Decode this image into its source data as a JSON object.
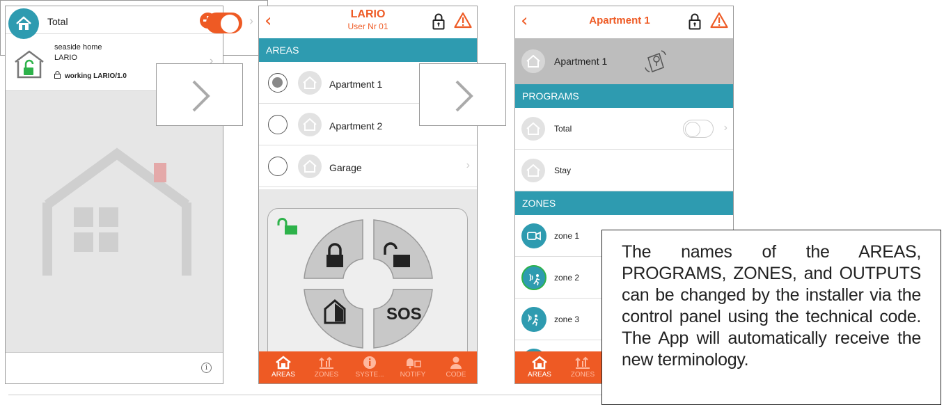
{
  "screen1": {
    "home_name": "seaside home",
    "panel_name": "LARIO",
    "status": "working LARIO/1.0",
    "info_glyph": "i",
    "icons": [
      "exit-icon",
      "add-icon",
      "house-unlocked-icon",
      "lock-icon",
      "info-icon"
    ]
  },
  "screen2": {
    "title": "LARIO",
    "subtitle": "User  Nr 01",
    "section_areas": "AREAS",
    "areas": [
      {
        "label": "Apartment 1",
        "selected": true
      },
      {
        "label": "Apartment 2",
        "selected": false
      },
      {
        "label": "Garage",
        "selected": false
      }
    ],
    "keypad_sos": "SOS",
    "tabs": [
      {
        "label": "AREAS",
        "active": true
      },
      {
        "label": "ZONES",
        "active": false
      },
      {
        "label": "SYSTE...",
        "active": false
      },
      {
        "label": "NOTIFY",
        "active": false
      },
      {
        "label": "CODE",
        "active": false
      }
    ]
  },
  "screen3": {
    "title": "Apartment 1",
    "area_label": "Apartment 1",
    "section_programs": "PROGRAMS",
    "programs": [
      {
        "label": "Total",
        "on": false
      },
      {
        "label": "Stay",
        "on": false
      }
    ],
    "section_zones": "ZONES",
    "zones": [
      {
        "label": "zone 1",
        "icon": "camera-icon"
      },
      {
        "label": "zone 2",
        "icon": "motion-sensor-icon"
      },
      {
        "label": "zone 3",
        "icon": "motion-sensor-icon"
      }
    ],
    "tabs": [
      {
        "label": "AREAS",
        "active": true
      },
      {
        "label": "ZONES",
        "active": false
      }
    ]
  },
  "callout_total": {
    "label": "Total",
    "on": true
  },
  "note": "The names of the AREAS, PROGRAMS, ZONES, and OUTPUTS can be changed by the installer via the control panel using the technical code. The App will automatically receive the new terminology.",
  "colors": {
    "accent": "#ee5a24",
    "teal": "#2e9bb0",
    "green": "#2db24a"
  }
}
